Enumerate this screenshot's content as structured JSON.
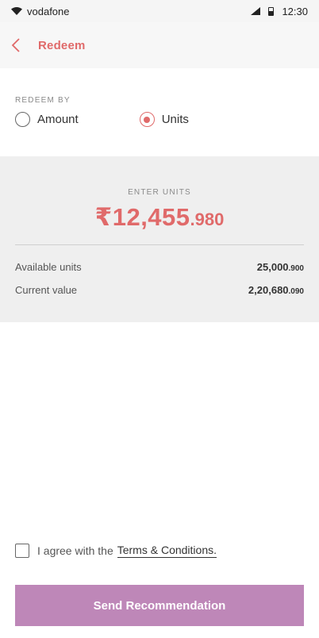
{
  "status_bar": {
    "carrier": "vodafone",
    "time": "12:30"
  },
  "header": {
    "title": "Redeem"
  },
  "redeem": {
    "label": "REDEEM BY",
    "options": [
      {
        "label": "Amount",
        "selected": false
      },
      {
        "label": "Units",
        "selected": true
      }
    ]
  },
  "units_panel": {
    "label": "ENTER UNITS",
    "value_main": "₹12,455",
    "value_decimal": ".980",
    "rows": [
      {
        "label": "Available units",
        "value_int": "25,000",
        "value_dec": ".900"
      },
      {
        "label": "Current value",
        "value_int": "2,20,680",
        "value_dec": ".090"
      }
    ]
  },
  "agreement": {
    "text": "I agree with the",
    "link": "Terms & Conditions.",
    "checked": false
  },
  "actions": {
    "send_label": "Send Recommendation"
  },
  "colors": {
    "accent": "#e06a6a",
    "button": "#be87b8",
    "panel": "#efefef"
  }
}
